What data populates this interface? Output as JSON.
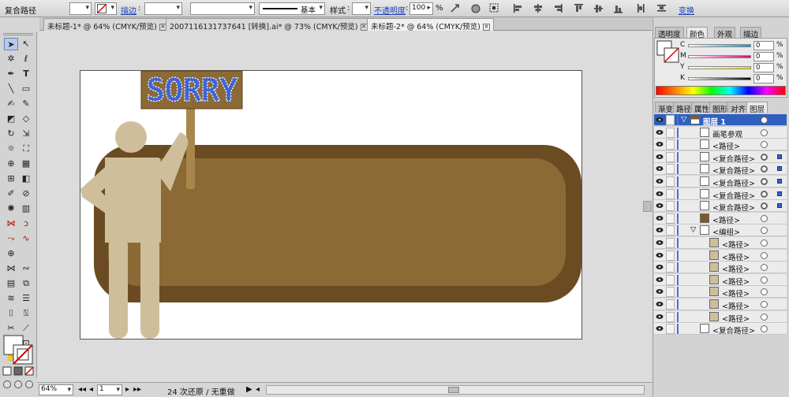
{
  "control_bar": {
    "object_type": "复合路径",
    "stroke_label": "描边",
    "stroke_style": "基本",
    "style_label": "样式",
    "opacity_label": "不透明度",
    "opacity_value": "100",
    "opacity_unit": "%",
    "transform_link": "变换"
  },
  "doc_tabs": [
    {
      "label": "未标题-1* @ 64% (CMYK/预览)"
    },
    {
      "label": "20071161317376​41 [转换].ai* @ 73% (CMYK/预览)"
    },
    {
      "label": "未标题-2* @ 64% (CMYK/预览)"
    }
  ],
  "artwork": {
    "sign_text": "SORRY"
  },
  "status_bar": {
    "zoom": "64%",
    "artboard": "1",
    "undo_info": "24 次还原 / 无重做"
  },
  "color_panel": {
    "tabs": [
      "透明度",
      "颜色",
      "外观",
      "描边"
    ],
    "active_tab": "颜色",
    "channels": [
      {
        "label": "C",
        "value": "0",
        "unit": "%",
        "color": "#00a0e0"
      },
      {
        "label": "M",
        "value": "0",
        "unit": "%",
        "color": "#e0007a"
      },
      {
        "label": "Y",
        "value": "0",
        "unit": "%",
        "color": "#f0e000"
      },
      {
        "label": "K",
        "value": "0",
        "unit": "%",
        "color": "#000000"
      }
    ]
  },
  "layers_panel": {
    "tabs": [
      "渐变",
      "路径",
      "属性",
      "图形",
      "对齐",
      "图层"
    ],
    "active_tab": "图层",
    "rows": [
      {
        "name": "图层 1",
        "indent": 0,
        "selected": true,
        "thumb": "layer"
      },
      {
        "name": "画笔参观",
        "indent": 1,
        "thumb": "white"
      },
      {
        "name": "<路径>",
        "indent": 1,
        "thumb": "white"
      },
      {
        "name": "<复合路径>",
        "indent": 1,
        "thumb": "white",
        "target_sel": true
      },
      {
        "name": "<复合路径>",
        "indent": 1,
        "thumb": "white",
        "target_sel": true
      },
      {
        "name": "<复合路径>",
        "indent": 1,
        "thumb": "white",
        "target_sel": true
      },
      {
        "name": "<复合路径>",
        "indent": 1,
        "thumb": "white",
        "target_sel": true
      },
      {
        "name": "<复合路径>",
        "indent": 1,
        "thumb": "white",
        "target_sel": true
      },
      {
        "name": "<路径>",
        "indent": 1,
        "thumb": "brown"
      },
      {
        "name": "<编组>",
        "indent": 1,
        "thumb": "white",
        "expand": true
      },
      {
        "name": "<路径>",
        "indent": 2,
        "thumb": "tan"
      },
      {
        "name": "<路径>",
        "indent": 2,
        "thumb": "tan"
      },
      {
        "name": "<路径>",
        "indent": 2,
        "thumb": "tan"
      },
      {
        "name": "<路径>",
        "indent": 2,
        "thumb": "tan"
      },
      {
        "name": "<路径>",
        "indent": 2,
        "thumb": "tan"
      },
      {
        "name": "<路径>",
        "indent": 2,
        "thumb": "tan"
      },
      {
        "name": "<路径>",
        "indent": 2,
        "thumb": "tan"
      },
      {
        "name": "<复合路径>",
        "indent": 1,
        "thumb": "white"
      }
    ]
  },
  "colors": {
    "brown_dark": "#6b4c22",
    "brown_mid": "#8c6a35",
    "figure_tan": "#cfbe9c",
    "sign_bg": "#8c6a35",
    "sign_text": "#3f63d8",
    "layer_select": "#2f5fbf"
  }
}
